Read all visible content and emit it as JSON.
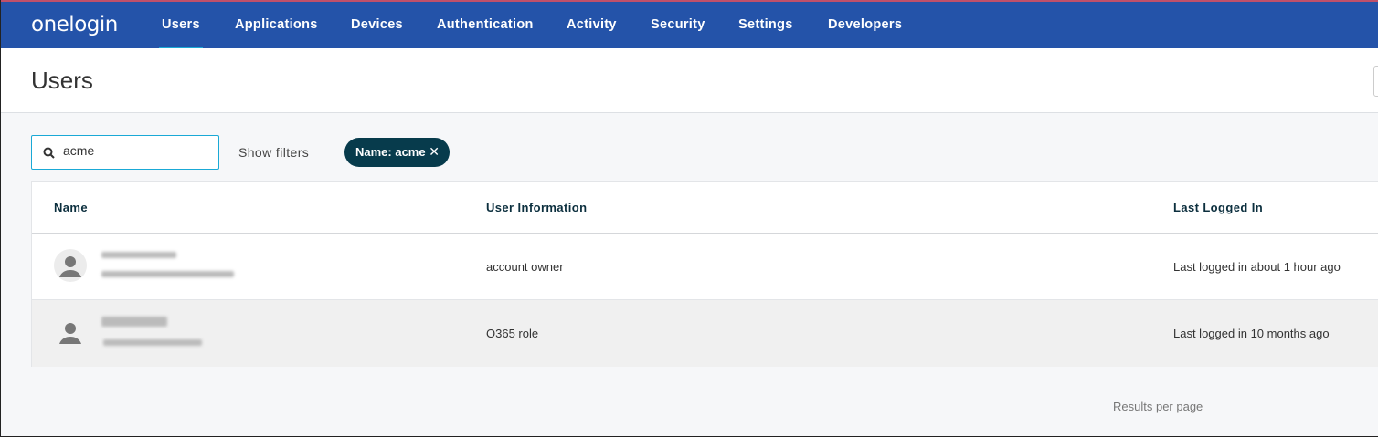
{
  "nav": {
    "logo": "onelogin",
    "items": [
      "Users",
      "Applications",
      "Devices",
      "Authentication",
      "Activity",
      "Security",
      "Settings",
      "Developers"
    ],
    "active": "Users"
  },
  "page": {
    "title": "Users"
  },
  "search": {
    "value": "acme",
    "show_filters": "Show filters"
  },
  "filter_chip": {
    "label": "Name: acme",
    "remove": "✕"
  },
  "table": {
    "headers": [
      "Name",
      "User Information",
      "Last Logged In"
    ],
    "rows": [
      {
        "info": "account owner",
        "last_login": "Last logged in about 1 hour ago"
      },
      {
        "info": "O365 role",
        "last_login": "Last logged in 10 months ago"
      }
    ]
  },
  "footer": {
    "results_per_page": "Results per page"
  },
  "colors": {
    "nav": "#2453a9",
    "accent": "#1aa9d6",
    "chip": "#073b4c"
  }
}
